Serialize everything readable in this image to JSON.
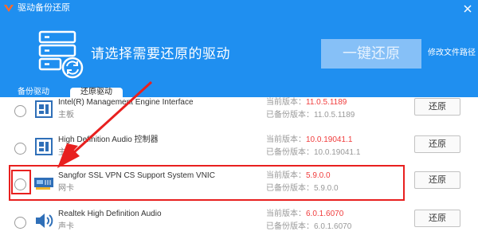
{
  "window": {
    "title": "驱动备份还原"
  },
  "header": {
    "prompt": "请选择需要还原的驱动",
    "restore_all_label": "一键还原",
    "change_path_label": "修改文件路径"
  },
  "tabs": {
    "backup": "备份驱动",
    "restore": "还原驱动"
  },
  "labels": {
    "current_version": "当前版本：",
    "backup_version": "已备份版本："
  },
  "colors": {
    "header": "#1f8ff0",
    "version_red": "#f03c3c",
    "annotation": "#e8201f"
  },
  "drivers": [
    {
      "name": "Intel(R) Management Engine Interface",
      "type": "主板",
      "current_version": "11.0.5.1189",
      "backup_version": "11.0.5.1189",
      "restore_label": "还原",
      "icon": "motherboard-icon"
    },
    {
      "name": "High Definition Audio 控制器",
      "type": "主板",
      "current_version": "10.0.19041.1",
      "backup_version": "10.0.19041.1",
      "restore_label": "还原",
      "icon": "motherboard-icon"
    },
    {
      "name": "Sangfor SSL VPN CS Support System VNIC",
      "type": "网卡",
      "current_version": "5.9.0.0",
      "backup_version": "5.9.0.0",
      "restore_label": "还原",
      "icon": "network-card-icon"
    },
    {
      "name": "Realtek High Definition Audio",
      "type": "声卡",
      "current_version": "6.0.1.6070",
      "backup_version": "6.0.1.6070",
      "restore_label": "还原",
      "icon": "speaker-icon"
    }
  ]
}
